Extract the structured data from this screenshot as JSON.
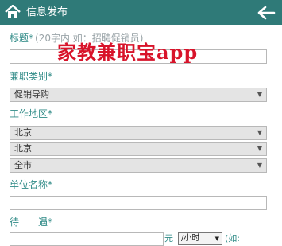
{
  "header": {
    "title": "信息发布"
  },
  "watermark": "家教兼职宝app",
  "form": {
    "title_label": "标题*",
    "title_hint": "(20字内 如：招聘促销员)",
    "title_value": "",
    "category_label": "兼职类别*",
    "category_value": "促销导购",
    "area_label": "工作地区*",
    "province_value": "北京",
    "city_value": "北京",
    "district_value": "全市",
    "company_label": "单位名称*",
    "company_value": "",
    "salary_label": "待　　遇*",
    "salary_value": "",
    "salary_currency": "元",
    "salary_unit": "/小时",
    "salary_hint": "(如:"
  }
}
